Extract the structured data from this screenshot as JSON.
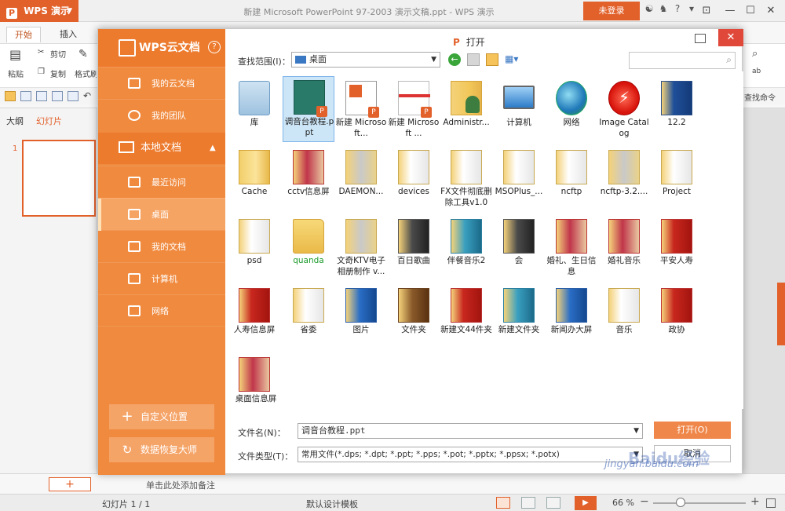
{
  "app": {
    "name": "WPS 演示",
    "window_title": "新建 Microsoft PowerPoint 97-2003 演示文稿.ppt - WPS 演示",
    "login": "未登录"
  },
  "ribbon": {
    "tabs": [
      "开始",
      "插入"
    ],
    "items": {
      "cut": "剪切",
      "copy": "复制",
      "paste": "粘贴",
      "format": "格式刷"
    },
    "right_tools": {
      "find": "查找命令"
    }
  },
  "slide_pane": {
    "tabs": [
      "大纲",
      "幻灯片"
    ],
    "thumb_number": "1"
  },
  "notes": {
    "placeholder": "单击此处添加备注"
  },
  "status": {
    "slide": "幻灯片 1 / 1",
    "design": "默认设计模板",
    "zoom": "66 %",
    "zoom_fraction": 0.3
  },
  "dialog": {
    "title": "打开",
    "sidebar": {
      "cloud_title": "WPS云文档",
      "cloud_items": [
        "我的云文档",
        "我的团队"
      ],
      "local_title": "本地文档",
      "local_items": [
        "最近访问",
        "桌面",
        "我的文档",
        "计算机",
        "网络"
      ],
      "custom_location": "自定义位置",
      "recovery": "数据恢复大师"
    },
    "lookin_label": "查找范围(I)：",
    "lookin_value": "桌面",
    "files": [
      {
        "label": "库",
        "icon": "library-icon"
      },
      {
        "label": "调音台教程.ppt",
        "icon": "ppt-file-icon",
        "selected": true
      },
      {
        "label": "新建 Microsoft...",
        "icon": "ppt-doc-icon"
      },
      {
        "label": "新建 Microsoft ...",
        "icon": "ppt-doc-icon"
      },
      {
        "label": "Administr...",
        "icon": "user-folder-icon"
      },
      {
        "label": "计算机",
        "icon": "computer-icon"
      },
      {
        "label": "网络",
        "icon": "network-icon"
      },
      {
        "label": "Image Catalog",
        "icon": "image-catalog-icon"
      },
      {
        "label": "12.2",
        "icon": "folder-icon"
      },
      {
        "label": "Cache",
        "icon": "folder-icon"
      },
      {
        "label": "cctv信息屏",
        "icon": "folder-icon"
      },
      {
        "label": "DAEMON...",
        "icon": "folder-icon"
      },
      {
        "label": "devices",
        "icon": "folder-icon"
      },
      {
        "label": "FX文件彻底删除工具v1.0",
        "icon": "folder-icon"
      },
      {
        "label": "MSOPlus_...",
        "icon": "folder-icon"
      },
      {
        "label": "ncftp",
        "icon": "folder-icon"
      },
      {
        "label": "ncftp-3.2....",
        "icon": "folder-icon"
      },
      {
        "label": "Project",
        "icon": "folder-icon"
      },
      {
        "label": "psd",
        "icon": "folder-icon"
      },
      {
        "label": "quanda",
        "icon": "folder-icon"
      },
      {
        "label": "文奇KTV电子相册制作 v...",
        "icon": "folder-icon"
      },
      {
        "label": "百日歌曲",
        "icon": "folder-icon"
      },
      {
        "label": "伴餐音乐2",
        "icon": "folder-icon"
      },
      {
        "label": "会",
        "icon": "folder-icon"
      },
      {
        "label": "婚礼、生日信息",
        "icon": "folder-icon"
      },
      {
        "label": "婚礼音乐",
        "icon": "folder-icon"
      },
      {
        "label": "平安人寿",
        "icon": "folder-icon"
      },
      {
        "label": "人寿信息屏",
        "icon": "folder-icon"
      },
      {
        "label": "省委",
        "icon": "folder-icon"
      },
      {
        "label": "图片",
        "icon": "folder-icon"
      },
      {
        "label": "文件夹",
        "icon": "folder-icon"
      },
      {
        "label": "新建文44件夹",
        "icon": "folder-icon"
      },
      {
        "label": "新建文件夹",
        "icon": "folder-icon"
      },
      {
        "label": "新闻办大屏",
        "icon": "folder-icon"
      },
      {
        "label": "音乐",
        "icon": "folder-icon"
      },
      {
        "label": "政协",
        "icon": "folder-icon"
      },
      {
        "label": "桌面信息屏",
        "icon": "folder-icon"
      }
    ],
    "filename_label": "文件名(N)：",
    "filename_value": "调音台教程.ppt",
    "filetype_label": "文件类型(T)：",
    "filetype_value": "常用文件(*.dps; *.dpt; *.ppt; *.pps; *.pot; *.pptx; *.ppsx; *.potx)",
    "open_button": "打开(O)",
    "cancel_button": "取消"
  },
  "watermark": {
    "text": "jingyan.baidu.com",
    "logo": "Baidu经验"
  },
  "colors": {
    "accent": "#e2612b",
    "sidebar": "#f08a3e",
    "selection": "#cde6f7"
  }
}
